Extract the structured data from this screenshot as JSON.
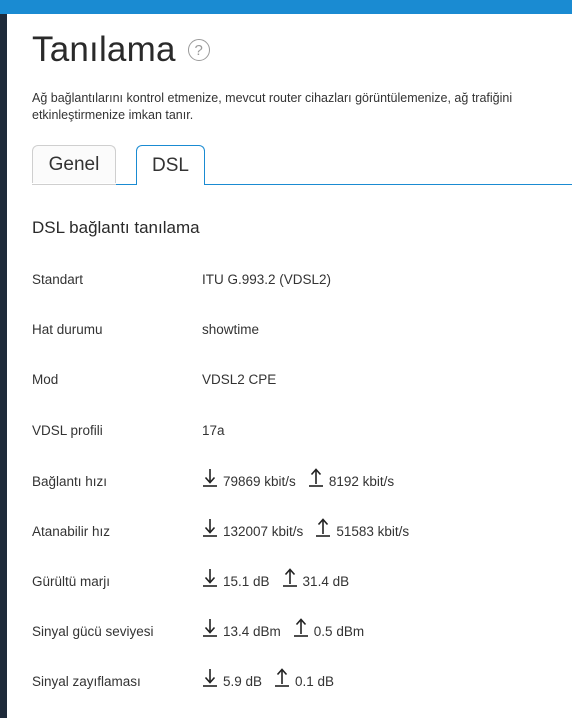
{
  "page": {
    "title": "Tanılama",
    "help_symbol": "?",
    "description_line1": "Ağ bağlantılarını kontrol etmenize, mevcut router cihazları görüntülemenize, ağ trafiğini",
    "description_line2": "etkinleştirmenize imkan tanır."
  },
  "tabs": [
    {
      "label": "Genel",
      "active": false
    },
    {
      "label": "DSL",
      "active": true
    }
  ],
  "section": {
    "title": "DSL bağlantı tanılama"
  },
  "rows": {
    "standard": {
      "label": "Standart",
      "value": "ITU G.993.2 (VDSL2)"
    },
    "line_status": {
      "label": "Hat durumu",
      "value": "showtime"
    },
    "mode": {
      "label": "Mod",
      "value": "VDSL2 CPE"
    },
    "vdsl_profile": {
      "label": "VDSL profili",
      "value": "17a"
    },
    "connection_speed": {
      "label": "Bağlantı hızı",
      "down": "79869 kbit/s",
      "up": "8192 kbit/s"
    },
    "attainable_speed": {
      "label": "Atanabilir hız",
      "down": "132007 kbit/s",
      "up": "51583 kbit/s"
    },
    "noise_margin": {
      "label": "Gürültü marjı",
      "down": "15.1 dB",
      "up": "31.4 dB"
    },
    "signal_power": {
      "label": "Sinyal gücü seviyesi",
      "down": "13.4 dBm",
      "up": "0.5 dBm"
    },
    "attenuation": {
      "label": "Sinyal zayıflaması",
      "down": "5.9 dB",
      "up": "0.1 dB"
    }
  },
  "icons": {
    "download": "download-arrow-icon",
    "upload": "upload-arrow-icon",
    "help": "help-circle-icon"
  },
  "colors": {
    "accent": "#1a8bd2",
    "sidebar": "#1e2a3a"
  }
}
